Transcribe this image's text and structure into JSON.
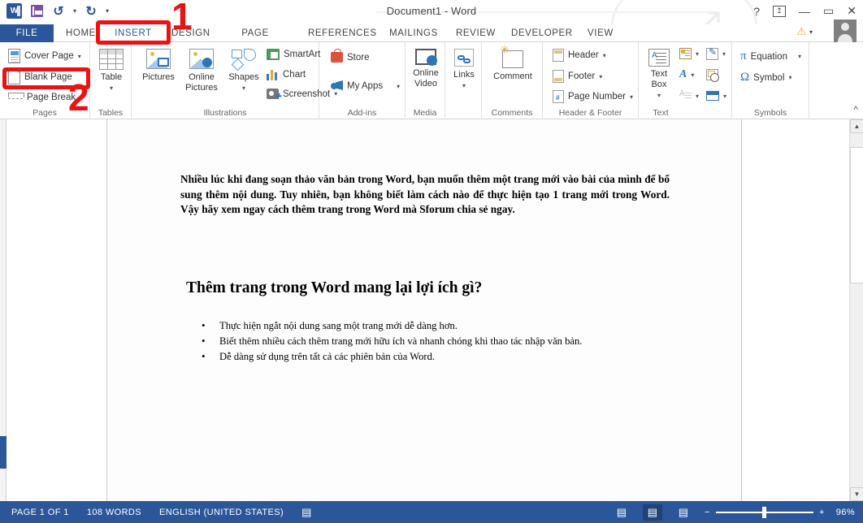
{
  "titlebar": {
    "document_title": "Document1 - Word",
    "qat": [
      {
        "name": "word-logo",
        "label": "W"
      },
      {
        "name": "save",
        "label": "Save"
      },
      {
        "name": "undo",
        "label": "↺"
      },
      {
        "name": "redo",
        "label": "↻"
      },
      {
        "name": "customize-qat",
        "label": "▾"
      }
    ],
    "window_controls": {
      "help": "?",
      "ribbon_display": "⊼",
      "minimize": "—",
      "restore": "▭",
      "close": "✕"
    }
  },
  "tabs": [
    {
      "label": "FILE",
      "active": false
    },
    {
      "label": "HOME",
      "active": false
    },
    {
      "label": "INSERT",
      "active": true
    },
    {
      "label": "DESIGN",
      "active": false
    },
    {
      "label": "PAGE LAYOUT",
      "active": false
    },
    {
      "label": "REFERENCES",
      "active": false
    },
    {
      "label": "MAILINGS",
      "active": false
    },
    {
      "label": "REVIEW",
      "active": false
    },
    {
      "label": "DEVELOPER",
      "active": false
    },
    {
      "label": "VIEW",
      "active": false
    }
  ],
  "ribbon": {
    "groups": [
      {
        "name": "Pages",
        "items": [
          {
            "label": "Cover Page",
            "has_dropdown": true
          },
          {
            "label": "Blank Page",
            "has_dropdown": false
          },
          {
            "label": "Page Break",
            "has_dropdown": false
          }
        ]
      },
      {
        "name": "Tables",
        "items": [
          {
            "label": "Table",
            "has_dropdown": true
          }
        ]
      },
      {
        "name": "Illustrations",
        "items": [
          {
            "label": "Pictures",
            "has_dropdown": false
          },
          {
            "label": "Online Pictures",
            "has_dropdown": false
          },
          {
            "label": "Shapes",
            "has_dropdown": true
          },
          {
            "label": "SmartArt",
            "has_dropdown": false
          },
          {
            "label": "Chart",
            "has_dropdown": false
          },
          {
            "label": "Screenshot",
            "has_dropdown": true
          }
        ]
      },
      {
        "name": "Add-ins",
        "items": [
          {
            "label": "Store",
            "has_dropdown": false
          },
          {
            "label": "My Apps",
            "has_dropdown": true
          }
        ]
      },
      {
        "name": "Media",
        "items": [
          {
            "label": "Online Video",
            "has_dropdown": false
          }
        ]
      },
      {
        "name": "Comments",
        "items": [
          {
            "label": "Comment",
            "has_dropdown": false
          }
        ]
      },
      {
        "name": "Header & Footer",
        "items": [
          {
            "label": "Header",
            "has_dropdown": true
          },
          {
            "label": "Footer",
            "has_dropdown": true
          },
          {
            "label": "Page Number",
            "has_dropdown": true
          }
        ]
      },
      {
        "name": "Text",
        "items": [
          {
            "label": "Text Box",
            "has_dropdown": true
          },
          {
            "label": "Quick Parts",
            "has_dropdown": true
          },
          {
            "label": "WordArt",
            "has_dropdown": true
          },
          {
            "label": "Drop Cap",
            "has_dropdown": true
          },
          {
            "label": "Signature Line",
            "has_dropdown": true
          },
          {
            "label": "Date & Time",
            "has_dropdown": false
          },
          {
            "label": "Object",
            "has_dropdown": true
          }
        ]
      },
      {
        "name": "Symbols",
        "items": [
          {
            "label": "Equation",
            "has_dropdown": true
          },
          {
            "label": "Symbol",
            "has_dropdown": true
          }
        ]
      }
    ],
    "links_label": "Links",
    "collapse_label": "^"
  },
  "document": {
    "paragraph": "Nhiều lúc khi đang soạn thảo văn bản trong Word, bạn muốn thêm một trang mới vào bài của mình để bổ sung thêm nội dung. Tuy nhiên, bạn không biết làm cách nào để thực hiện tạo 1 trang mới trong Word. Vậy hãy xem ngay cách thêm trang trong Word mà Sforum chia sẻ ngay.",
    "heading": "Thêm trang trong Word mang lại lợi ích gì?",
    "bullets": [
      "Thực hiện ngắt nội dung sang một trang mới dễ dàng hơn.",
      "Biết thêm nhiều cách thêm trang mới hữu ích và nhanh chóng khi thao tác nhập văn bản.",
      "Dễ dàng sử dụng trên tất cả các phiên bản của Word."
    ]
  },
  "statusbar": {
    "page_info": "PAGE 1 OF 1",
    "word_count": "108 WORDS",
    "language": "ENGLISH (UNITED STATES)",
    "proofing_icon": "proofing-errors-icon",
    "views": [
      {
        "name": "read-mode",
        "glyph": "▤",
        "active": false
      },
      {
        "name": "print-layout",
        "glyph": "▤",
        "active": true
      },
      {
        "name": "web-layout",
        "glyph": "▤",
        "active": false
      }
    ],
    "zoom_out": "−",
    "zoom_in": "+",
    "zoom_level": "96%"
  },
  "annotations": [
    {
      "name": "step-1",
      "label": "1"
    },
    {
      "name": "step-2",
      "label": "2"
    }
  ],
  "colors": {
    "word_blue": "#2b579a",
    "annotation_red": "#ee1111"
  }
}
